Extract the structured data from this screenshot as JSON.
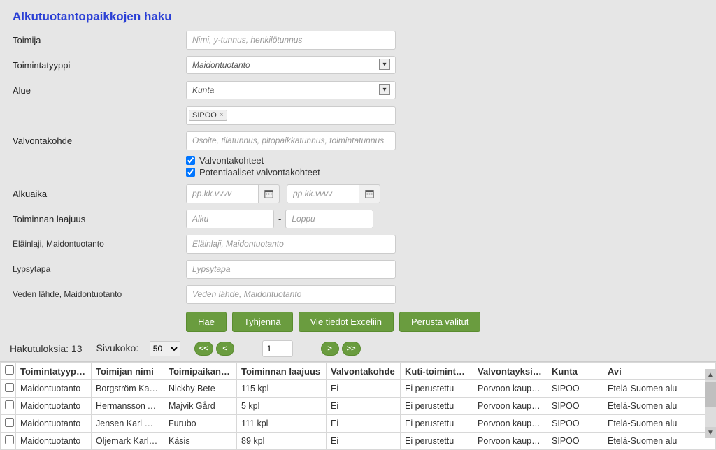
{
  "title": "Alkutuotantopaikkojen haku",
  "form": {
    "toimija": {
      "label": "Toimija",
      "placeholder": "Nimi, y-tunnus, henkilötunnus"
    },
    "toimintatyyppi": {
      "label": "Toimintatyyppi",
      "value": "Maidontuotanto"
    },
    "alue": {
      "label": "Alue",
      "value": "Kunta",
      "tag": "SIPOO"
    },
    "valvontakohde": {
      "label": "Valvontakohde",
      "placeholder": "Osoite, tilatunnus, pitopaikkatunnus, toimintatunnus"
    },
    "chk_valvontakohteet": "Valvontakohteet",
    "chk_potentiaaliset": "Potentiaaliset valvontakohteet",
    "alkuaika": {
      "label": "Alkuaika",
      "placeholder": "pp.kk.vvvv"
    },
    "laajuus": {
      "label": "Toiminnan laajuus",
      "from": "Alku",
      "to": "Loppu"
    },
    "elainlaji": {
      "label": "Eläinlaji, Maidontuotanto",
      "placeholder": "Eläinlaji, Maidontuotanto"
    },
    "lypsytapa": {
      "label": "Lypsytapa",
      "placeholder": "Lypsytapa"
    },
    "veden": {
      "label": "Veden lähde, Maidontuotanto",
      "placeholder": "Veden lähde, Maidontuotanto"
    },
    "buttons": {
      "hae": "Hae",
      "tyhjenna": "Tyhjennä",
      "excel": "Vie tiedot Exceliin",
      "perusta": "Perusta valitut"
    }
  },
  "results": {
    "count_label": "Hakutuloksia: 13",
    "pagesize_label": "Sivukoko:",
    "pagesize": "50",
    "page": "1",
    "columns": [
      "Toimintatyyppi",
      "Toimijan nimi",
      "Toimipaikan…",
      "Toiminnan laajuus",
      "Valvontakohde",
      "Kuti-toimint…",
      "Valvontayksi…",
      "Kunta",
      "Avi"
    ],
    "rows": [
      {
        "tt": "Maidontuotanto",
        "nimi": "Borgström Karl H",
        "paikka": "Nickby Bete",
        "laajuus": "115 kpl",
        "kohde": "Ei",
        "kuti": "Ei perustettu",
        "yks": "Porvoon kaupunk",
        "kunta": "SIPOO",
        "avi": "Etelä-Suomen alu"
      },
      {
        "tt": "Maidontuotanto",
        "nimi": "Hermansson Atte",
        "paikka": "Majvik Gård",
        "laajuus": "5 kpl",
        "kohde": "Ei",
        "kuti": "Ei perustettu",
        "yks": "Porvoon kaupunk",
        "kunta": "SIPOO",
        "avi": "Etelä-Suomen alu"
      },
      {
        "tt": "Maidontuotanto",
        "nimi": "Jensen Karl Chri",
        "paikka": "Furubo",
        "laajuus": "111 kpl",
        "kohde": "Ei",
        "kuti": "Ei perustettu",
        "yks": "Porvoon kaupunk",
        "kunta": "SIPOO",
        "avi": "Etelä-Suomen alu"
      },
      {
        "tt": "Maidontuotanto",
        "nimi": "Oljemark Karl-eri",
        "paikka": "Käsis",
        "laajuus": "89 kpl",
        "kohde": "Ei",
        "kuti": "Ei perustettu",
        "yks": "Porvoon kaupunk",
        "kunta": "SIPOO",
        "avi": "Etelä-Suomen alu"
      }
    ]
  }
}
